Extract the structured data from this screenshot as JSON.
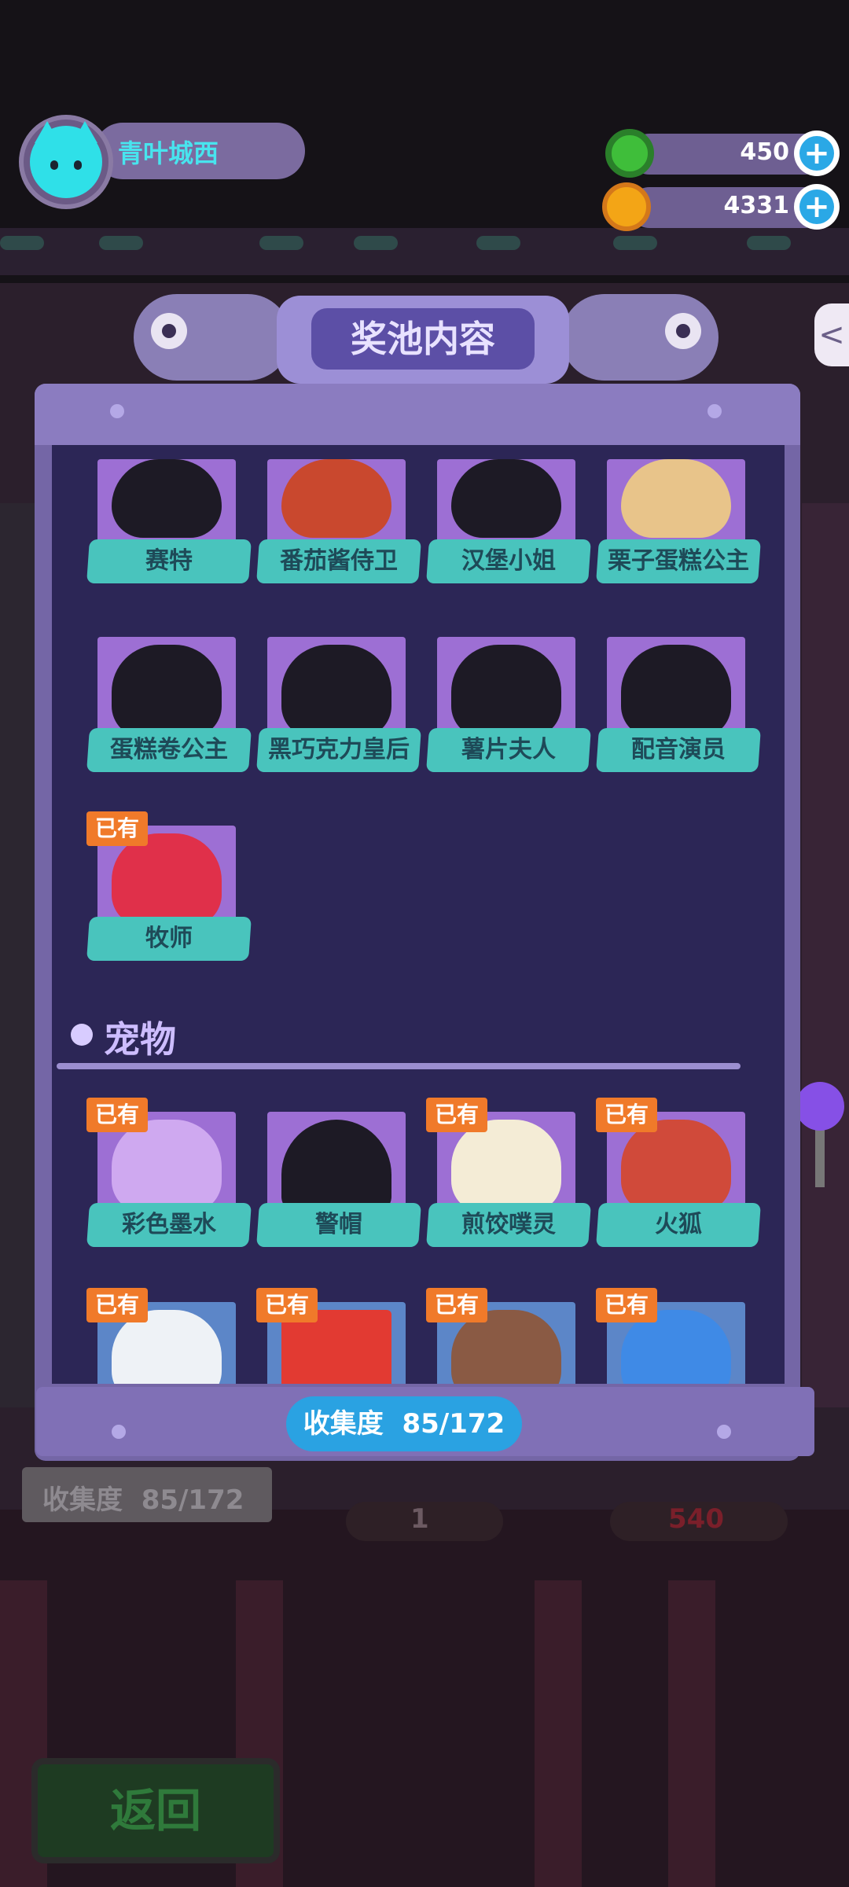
{
  "player": {
    "name": "青叶城西"
  },
  "currency": [
    {
      "icon": "green-donut-icon",
      "value": "450",
      "plus": "+"
    },
    {
      "icon": "planet-coin-icon",
      "value": "4331",
      "plus": "+"
    }
  ],
  "dialog": {
    "title": "奖池内容",
    "items_row1": [
      {
        "name": "赛特",
        "owned": false
      },
      {
        "name": "番茄酱侍卫",
        "owned": false
      },
      {
        "name": "汉堡小姐",
        "owned": false
      },
      {
        "name": "栗子蛋糕公主",
        "owned": false
      }
    ],
    "items_row2": [
      {
        "name": "蛋糕卷公主",
        "owned": false
      },
      {
        "name": "黑巧克力皇后",
        "owned": false
      },
      {
        "name": "薯片夫人",
        "owned": false
      },
      {
        "name": "配音演员",
        "owned": false
      }
    ],
    "items_row3": [
      {
        "name": "牧师",
        "owned": true,
        "badge": "已有"
      }
    ],
    "pets_section": "宠物",
    "pets_row1": [
      {
        "name": "彩色墨水",
        "owned": true,
        "badge": "已有"
      },
      {
        "name": "警帽",
        "owned": false
      },
      {
        "name": "煎饺噗灵",
        "owned": true,
        "badge": "已有"
      },
      {
        "name": "火狐",
        "owned": true,
        "badge": "已有"
      }
    ],
    "pets_row2_badges": [
      "已有",
      "已有",
      "已有",
      "已有"
    ],
    "progress_label": "收集度",
    "progress_value": "85/172"
  },
  "underlay": {
    "collection_label": "收集度",
    "collection_value": "85/172",
    "count_value": "1",
    "price_value": "540",
    "back_label": "返回"
  },
  "colors": {
    "owned_badge": "#f07a2a",
    "label_bar": "#49c4bd",
    "card_bg": "#9d6fd4",
    "panel_bg": "#2c2656",
    "progress_pill": "#2aa2e2"
  }
}
